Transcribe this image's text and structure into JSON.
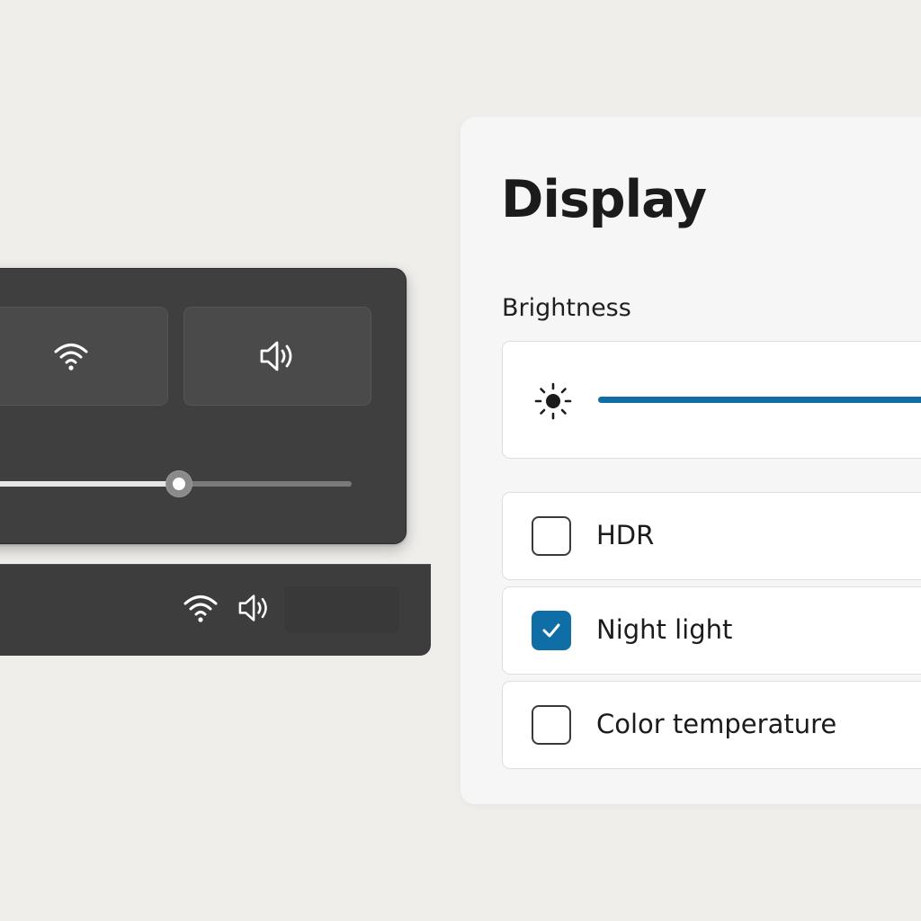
{
  "quick_settings": {
    "tiles": [
      {
        "icon": "wifi-icon"
      },
      {
        "icon": "volume-icon"
      }
    ],
    "volume_level": 0.52
  },
  "taskbar": {
    "tray_icons": [
      "wifi-icon",
      "volume-icon"
    ]
  },
  "display_panel": {
    "title": "Display",
    "brightness": {
      "label": "Brightness",
      "icon": "sun-icon",
      "value": 1.0
    },
    "options": [
      {
        "label": "HDR",
        "checked": false
      },
      {
        "label": "Night light",
        "checked": true
      },
      {
        "label": "Color temperature",
        "checked": false
      }
    ]
  },
  "colors": {
    "accent": "#0f6ea6",
    "dark_surface": "#3f3f3f",
    "background": "#efeeeb"
  }
}
